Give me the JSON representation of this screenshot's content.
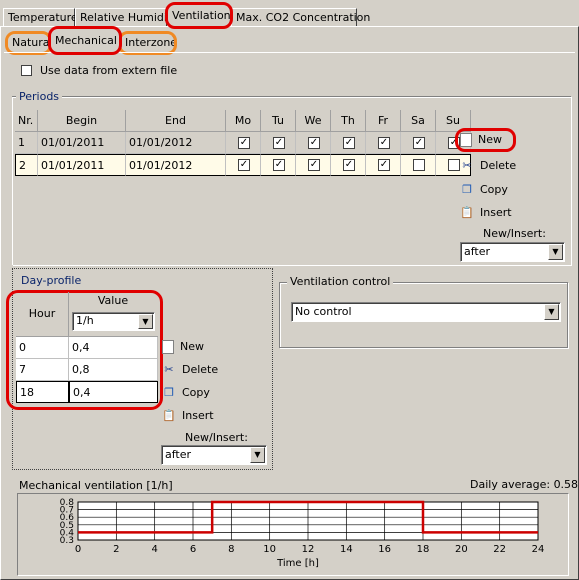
{
  "tabs": [
    "Temperature",
    "Relative Humidity",
    "Ventilation",
    "Max. CO2 Concentration"
  ],
  "subtabs": [
    "Natural",
    "Mechanical",
    "Interzone"
  ],
  "extern_file_label": "Use data from extern file",
  "periods": {
    "title": "Periods",
    "columns": [
      "Nr.",
      "Begin",
      "End",
      "Mo",
      "Tu",
      "We",
      "Th",
      "Fr",
      "Sa",
      "Su"
    ],
    "rows": [
      {
        "nr": "1",
        "begin": "01/01/2011",
        "end": "01/01/2012",
        "days": [
          true,
          true,
          true,
          true,
          true,
          true,
          true
        ]
      },
      {
        "nr": "2",
        "begin": "01/01/2011",
        "end": "01/01/2012",
        "days": [
          true,
          true,
          true,
          true,
          true,
          false,
          false
        ]
      }
    ],
    "buttons": {
      "new": "New",
      "delete": "Delete",
      "copy": "Copy",
      "insert": "Insert"
    },
    "new_insert_label": "New/Insert:",
    "new_insert_value": "after"
  },
  "day_profile": {
    "title": "Day-profile",
    "hour_header": "Hour",
    "value_header": "Value",
    "unit": "1/h",
    "rows": [
      {
        "hour": "0",
        "value": "0,4"
      },
      {
        "hour": "7",
        "value": "0,8"
      },
      {
        "hour": "18",
        "value": "0,4"
      }
    ],
    "buttons": {
      "new": "New",
      "delete": "Delete",
      "copy": "Copy",
      "insert": "Insert"
    },
    "new_insert_label": "New/Insert:",
    "new_insert_value": "after"
  },
  "ventilation_control": {
    "title": "Ventilation control",
    "value": "No control"
  },
  "chart": {
    "title": "Mechanical ventilation [1/h]",
    "daily_average": "Daily average: 0.58",
    "xlabel": "Time [h]",
    "y_ticks": [
      "0.8",
      "0.7",
      "0.6",
      "0.5",
      "0.4",
      "0.3"
    ],
    "x_ticks": [
      "0",
      "2",
      "4",
      "6",
      "8",
      "10",
      "12",
      "14",
      "16",
      "18",
      "20",
      "22",
      "24"
    ]
  },
  "chart_data": {
    "type": "line",
    "title": "Mechanical ventilation [1/h]",
    "xlabel": "Time [h]",
    "ylabel": "",
    "xlim": [
      0,
      24
    ],
    "ylim": [
      0.3,
      0.8
    ],
    "series": [
      {
        "x": [
          0,
          7,
          7,
          18,
          18,
          24
        ],
        "y": [
          0.4,
          0.4,
          0.8,
          0.8,
          0.4,
          0.4
        ]
      }
    ],
    "color": "#cc0000",
    "grid": true
  }
}
